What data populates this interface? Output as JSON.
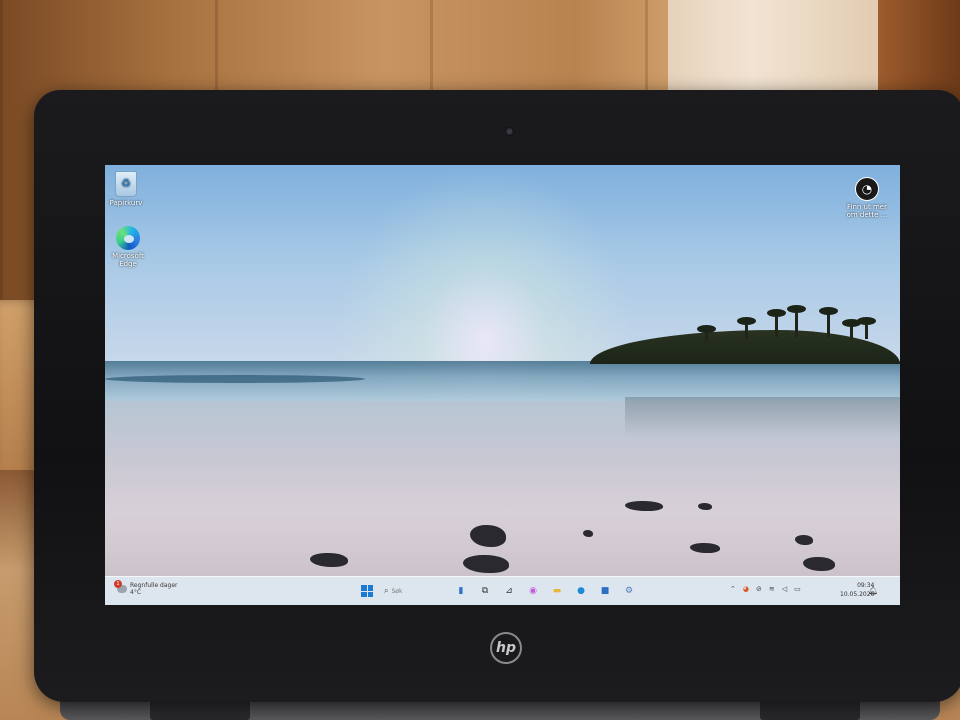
{
  "desktop": {
    "icons": [
      {
        "label": "Papirkurv",
        "icon": "recycle-bin-icon"
      },
      {
        "label_line1": "Microsoft",
        "label_line2": "Edge",
        "icon": "edge-icon"
      }
    ],
    "promo": {
      "label_line1": "Finn ut mer",
      "label_line2": "om dette ...",
      "icon": "learn-more-icon"
    }
  },
  "taskbar": {
    "weather": {
      "text": "Regnfulle dager",
      "temp": "4°C",
      "badge": "1"
    },
    "search_placeholder": "Søk",
    "apps": [
      "widgets-icon",
      "task-view-icon",
      "file-explorer-icon",
      "copilot-icon",
      "folder-icon",
      "edge-icon",
      "store-icon",
      "settings-icon"
    ],
    "tray_icons": [
      "chevron-up-icon",
      "color-icon",
      "network-off-icon",
      "wifi-icon",
      "volume-icon",
      "battery-icon"
    ],
    "time": "09:34",
    "date": "10.05.2026"
  },
  "hardware": {
    "brand": "hp"
  }
}
